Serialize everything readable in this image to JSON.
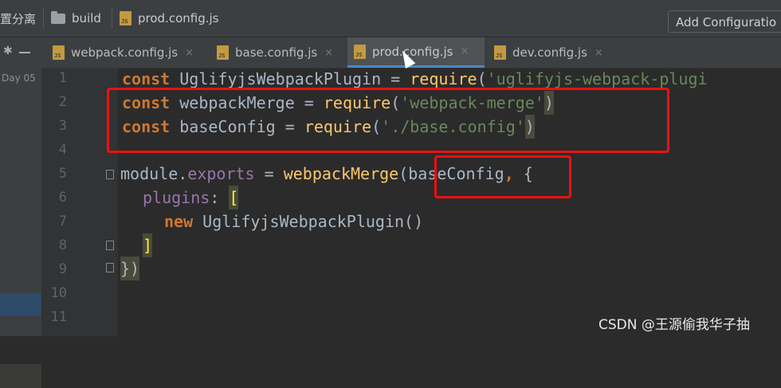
{
  "breadcrumb": {
    "project_partial": "置分离",
    "folder": "build",
    "file": "prod.config.js"
  },
  "toolbar": {
    "add_configuration": "Add Configuratio"
  },
  "tabs": [
    {
      "label": "webpack.config.js"
    },
    {
      "label": "base.config.js"
    },
    {
      "label": "prod.config.js"
    },
    {
      "label": "dev.config.js"
    }
  ],
  "tab_close": "×",
  "sidebar": {
    "day_label": "Day 05"
  },
  "line_numbers": [
    "1",
    "2",
    "3",
    "4",
    "5",
    "6",
    "7",
    "8",
    "9",
    "10",
    "11"
  ],
  "code": {
    "line1": {
      "kw": "const",
      "name": "UglifyjsWebpackPlugin",
      "eq": " = ",
      "fn": "require",
      "open": "(",
      "str": "'uglifyjs-webpack-plugi"
    },
    "line2": {
      "kw": "const",
      "name": "webpackMerge",
      "eq": " = ",
      "fn": "require",
      "open": "(",
      "str": "'webpack-merge'",
      "close": ")"
    },
    "line3": {
      "kw": "const",
      "name": "baseConfig",
      "eq": " = ",
      "fn": "require",
      "open": "(",
      "str": "'./base.config'",
      "close": ")"
    },
    "line5": {
      "obj": "module",
      "dot": ".",
      "prop": "exports",
      "eq": " = ",
      "fn": "webpackMerge",
      "open": "(",
      "arg": "baseConfig",
      "comma": ",",
      "brace": " {"
    },
    "line6": {
      "prop": "plugins",
      "colon": ": ",
      "bracket": "["
    },
    "line7": {
      "kw": "new",
      "cls": "UglifyjsWebpackPlugin",
      "paren": "()"
    },
    "line8": {
      "bracket": "]"
    },
    "line9": {
      "close": "})"
    }
  },
  "watermark": "CSDN @王源偷我华子抽",
  "colors": {
    "highlight_box": "#ee1111",
    "keyword": "#cc7832",
    "string": "#6a8759",
    "function": "#ffc66d"
  }
}
